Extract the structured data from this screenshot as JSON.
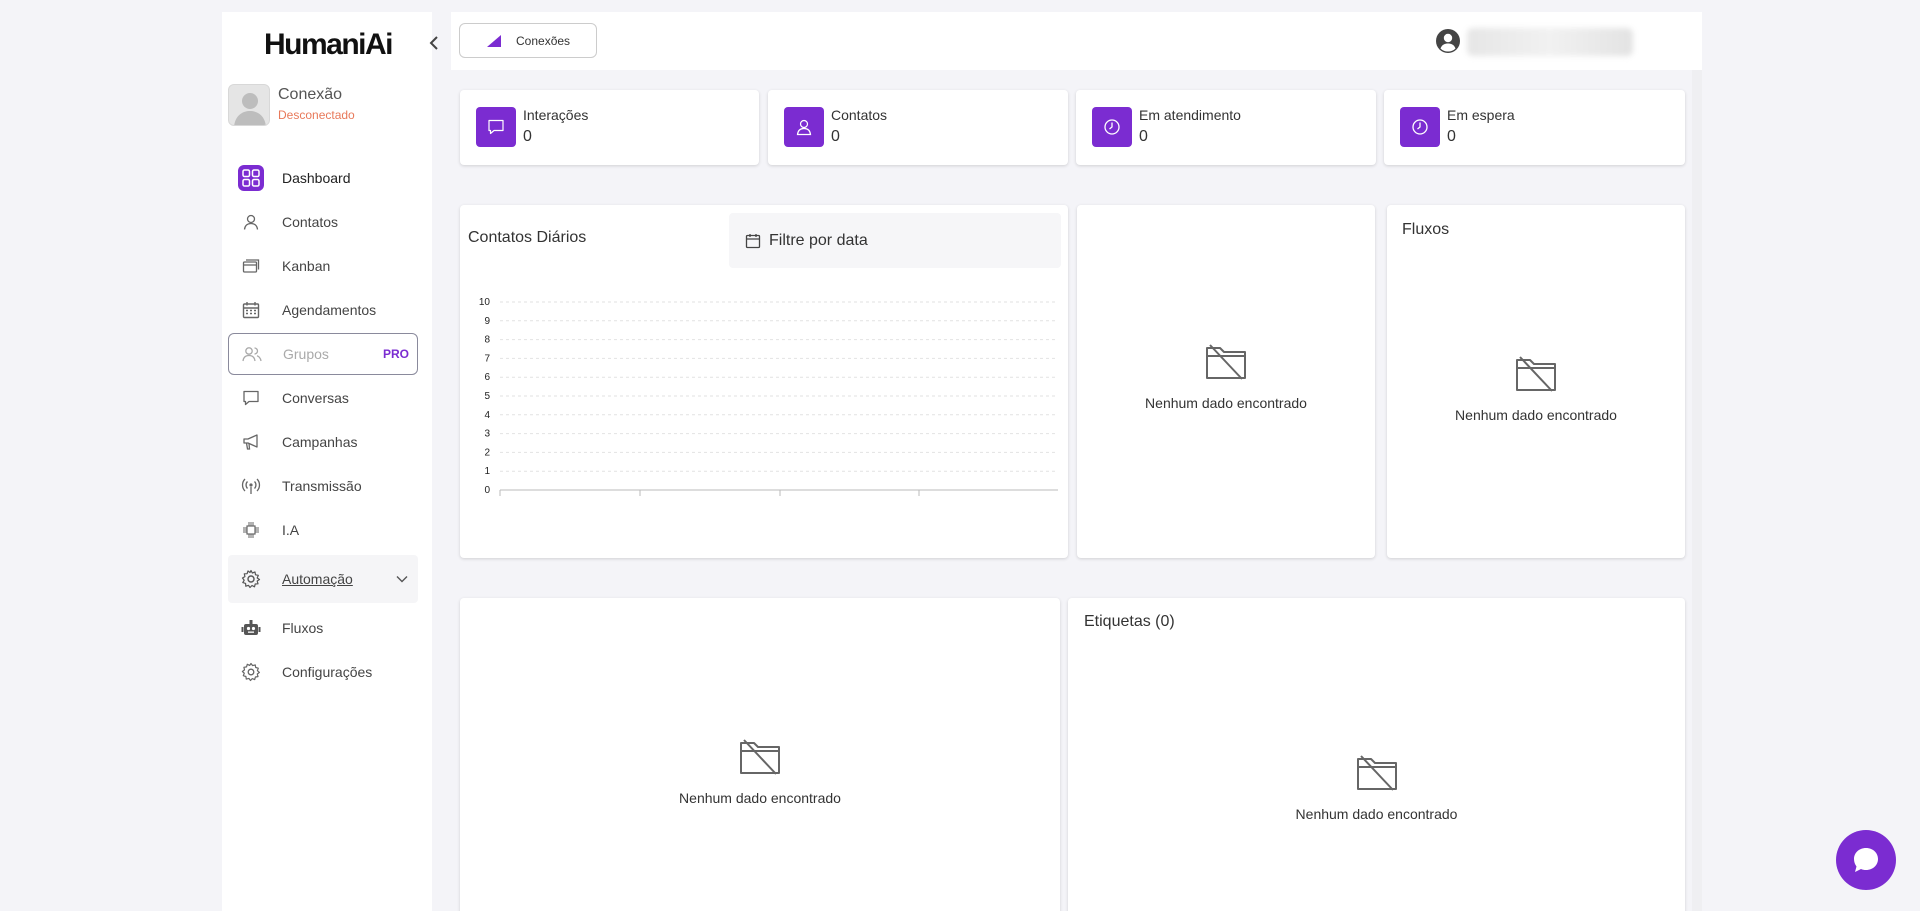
{
  "sidebar": {
    "logo": "HumaniAi",
    "profile": {
      "name": "Conexão",
      "status": "Desconectado"
    },
    "items": [
      {
        "label": "Dashboard"
      },
      {
        "label": "Contatos"
      },
      {
        "label": "Kanban"
      },
      {
        "label": "Agendamentos"
      },
      {
        "label": "Grupos",
        "badge": "PRO"
      },
      {
        "label": "Conversas"
      },
      {
        "label": "Campanhas"
      },
      {
        "label": "Transmissão"
      },
      {
        "label": "I.A"
      },
      {
        "label": "Automação"
      },
      {
        "label": "Fluxos"
      },
      {
        "label": "Configurações"
      }
    ]
  },
  "topbar": {
    "connections_button": "Conexões"
  },
  "stats": [
    {
      "label": "Interações",
      "value": "0",
      "icon": "message-icon"
    },
    {
      "label": "Contatos",
      "value": "0",
      "icon": "person-icon"
    },
    {
      "label": "Em atendimento",
      "value": "0",
      "icon": "clock-icon"
    },
    {
      "label": "Em espera",
      "value": "0",
      "icon": "clock-icon"
    }
  ],
  "daily_contacts": {
    "title": "Contatos Diários",
    "filter_label": "Filtre por data"
  },
  "chart_data": {
    "type": "line",
    "title": "Contatos Diários",
    "x": [],
    "series": [],
    "yticks": [
      "0",
      "1",
      "2",
      "3",
      "4",
      "5",
      "6",
      "7",
      "8",
      "9",
      "10"
    ],
    "ylim": [
      0,
      10
    ],
    "grid": true
  },
  "panels": {
    "empty_text": "Nenhum dado encontrado",
    "fluxos_title": "Fluxos",
    "etiquetas_title": "Etiquetas (0)"
  },
  "colors": {
    "accent": "#7b2cd1",
    "status_disconnected": "#e8795a"
  }
}
